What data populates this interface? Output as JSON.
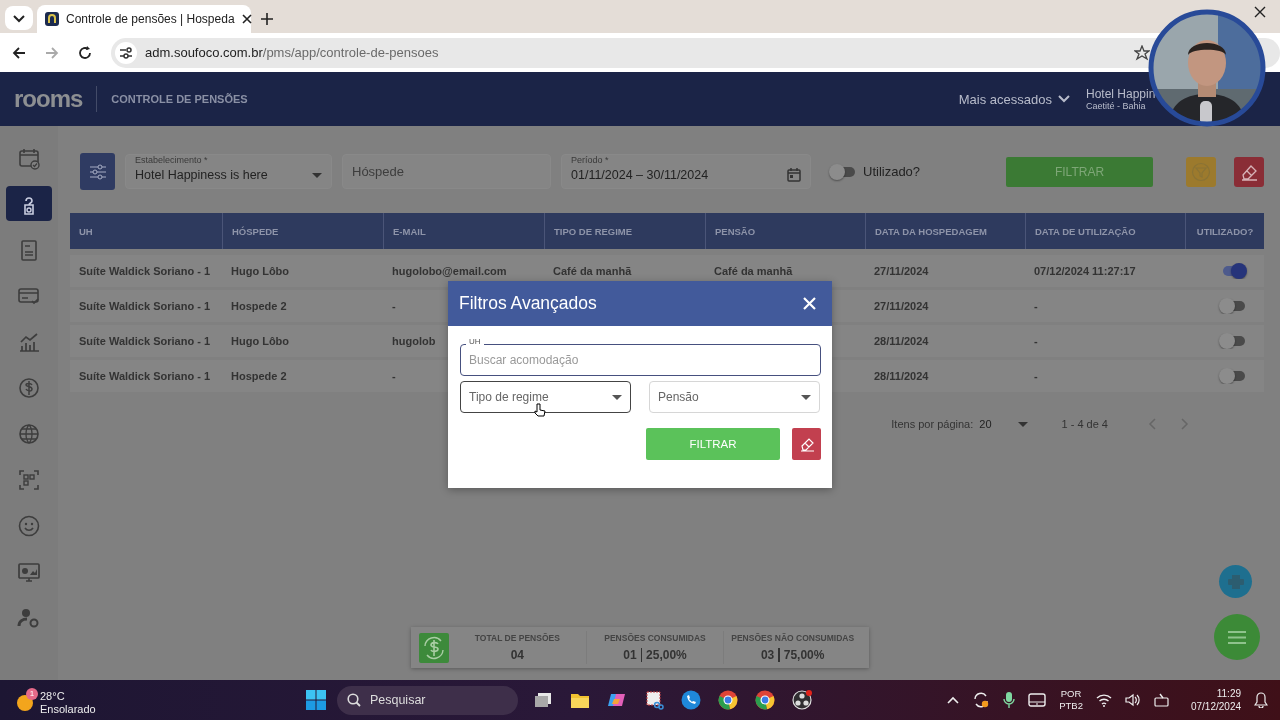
{
  "browser": {
    "tab": {
      "title": "Controle de pensões | Hospeda"
    },
    "url": {
      "host": "adm.soufoco.com.br",
      "path": "/pms/app/controle-de-pensoes"
    }
  },
  "app_header": {
    "logo": "rooms",
    "page_title": "CONTROLE DE PENSÕES",
    "menu": "Mais acessados",
    "hotel": {
      "name": "Hotel Happin",
      "location": "Caetité - Bahia"
    }
  },
  "sidebar": {
    "items": [
      {
        "selected": false
      },
      {
        "selected": true
      },
      {
        "selected": false
      },
      {
        "selected": false
      },
      {
        "selected": false
      },
      {
        "selected": false
      },
      {
        "selected": false
      },
      {
        "selected": false
      },
      {
        "selected": false
      },
      {
        "selected": false
      },
      {
        "selected": false
      }
    ]
  },
  "filters": {
    "establishment": {
      "label": "Estabelecimento *",
      "value": "Hotel Happiness is here"
    },
    "guest": {
      "placeholder": "Hóspede"
    },
    "period": {
      "label": "Período *",
      "value": "01/11/2024 – 30/11/2024"
    },
    "used_toggle": {
      "label": "Utilizado?",
      "on": false
    },
    "filter_button": "FILTRAR"
  },
  "table": {
    "columns": [
      "UH",
      "HÓSPEDE",
      "E-MAIL",
      "TIPO DE REGIME",
      "PENSÃO",
      "DATA DA HOSPEDAGEM",
      "DATA DE UTILIZAÇÃO",
      "UTILIZADO?"
    ],
    "rows": [
      {
        "uh": "Suíte Waldick Soriano - 1",
        "guest": "Hugo Lôbo",
        "email": "hugolobo@email.com",
        "regime": "Café da manhã",
        "pension": "Café da manhã",
        "stay_date": "27/11/2024",
        "use_date": "07/12/2024 11:27:17",
        "used": true
      },
      {
        "uh": "Suíte Waldick Soriano - 1",
        "guest": "Hospede 2",
        "email": "-",
        "stay_date": "27/11/2024",
        "use_date": "-",
        "used": false
      },
      {
        "uh": "Suíte Waldick Soriano - 1",
        "guest": "Hugo Lôbo",
        "email": "hugolob",
        "stay_date": "28/11/2024",
        "use_date": "-",
        "used": false
      },
      {
        "uh": "Suíte Waldick Soriano - 1",
        "guest": "Hospede 2",
        "email": "-",
        "stay_date": "28/11/2024",
        "use_date": "-",
        "used": false
      }
    ]
  },
  "pagination": {
    "label": "Itens por página:",
    "per_page": "20",
    "range": "1 - 4 de 4"
  },
  "summary": [
    {
      "label": "TOTAL DE PENSÕES",
      "value": "04"
    },
    {
      "label": "PENSÕES CONSUMIDAS",
      "value": "01",
      "percent": "25,00%"
    },
    {
      "label": "PENSÕES NÃO CONSUMIDAS",
      "value": "03",
      "percent": "75,00%"
    }
  ],
  "modal": {
    "title": "Filtros Avançados",
    "uh": {
      "label": "UH",
      "placeholder": "Buscar acomodação"
    },
    "regime": {
      "placeholder": "Tipo de regime"
    },
    "pension": {
      "placeholder": "Pensão"
    },
    "filter_button": "FILTRAR"
  },
  "taskbar": {
    "weather": {
      "badge": "1",
      "temperature": "28°C",
      "condition": "Ensolarado"
    },
    "search": {
      "placeholder": "Pesquisar"
    },
    "language": [
      "POR",
      "PTB2"
    ],
    "time": "11:29",
    "date": "07/12/2024"
  }
}
